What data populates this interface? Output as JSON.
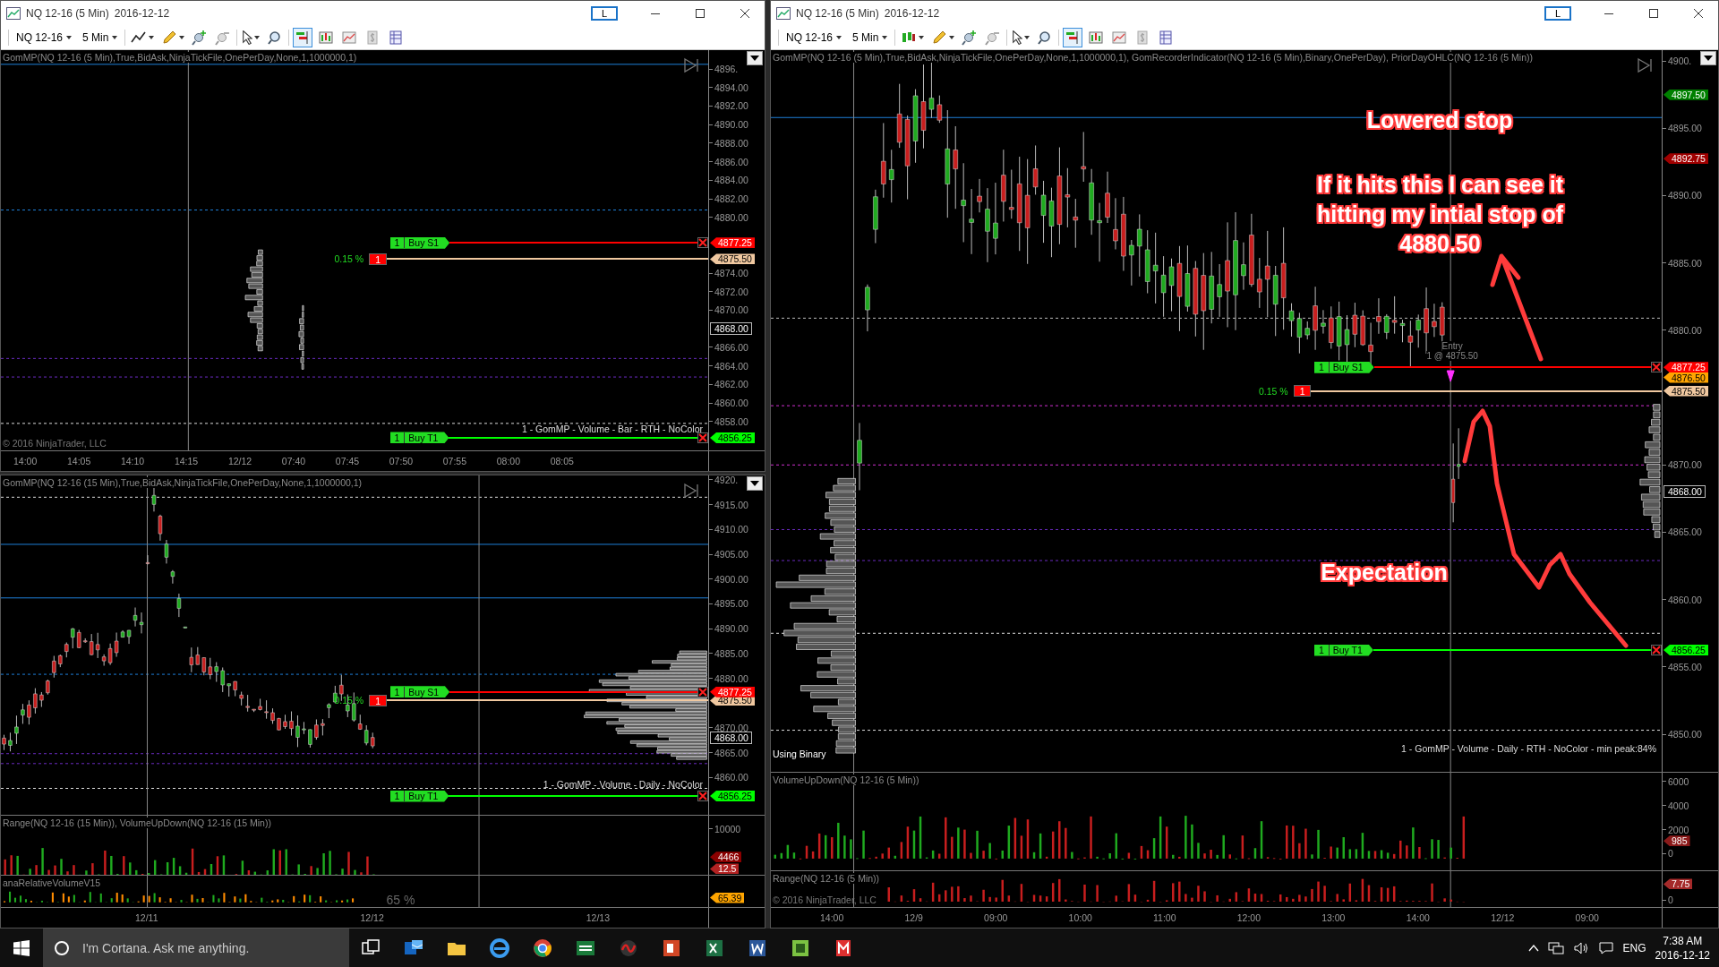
{
  "charts": [
    {
      "title": "NQ 12-16 (5 Min)",
      "date": "2016-12-12",
      "link_button": "L",
      "instrument": "NQ 12-16",
      "interval": "5 Min",
      "panels": [
        {
          "kind": "price",
          "label": "GomMP(NQ 12-16 (5 Min),True,BidAsk,NinjaTickFile,OnePerDay,None,1,1000000,1)",
          "ticks": [
            "4896.",
            "4894.00",
            "4892.00",
            "4890.00",
            "4888.00",
            "4886.00",
            "4884.00",
            "4882.00",
            "4880.00",
            "4874.00",
            "4872.00",
            "4870.00",
            "4866.00",
            "4864.00",
            "4862.00",
            "4860.00",
            "4858.00"
          ],
          "markers": [
            {
              "text": "4877.25",
              "color": "#ff0000",
              "order": {
                "kind": "stop",
                "qty": "1",
                "label": "Buy S1"
              }
            },
            {
              "text": "4875.50",
              "color": "#f0c8a0",
              "order": {
                "kind": "entry",
                "percent": "0.15 %",
                "qty": "1"
              }
            },
            {
              "text": "4868.00",
              "color": "#000000"
            },
            {
              "text": "4856.25",
              "color": "#00ff00",
              "order": {
                "kind": "target",
                "qty": "1",
                "label": "Buy T1"
              }
            }
          ],
          "notes": [
            {
              "kind": "profile",
              "text": "1 - GomMP - Volume - Bar - RTH - NoColor"
            },
            {
              "kind": "copyright",
              "text": "© 2016 NinjaTrader, LLC"
            }
          ]
        }
      ],
      "time_axis": [
        "14:00",
        "14:05",
        "14:10",
        "14:15",
        "12/12",
        "07:40",
        "07:45",
        "07:50",
        "07:55",
        "08:00",
        "08:05"
      ]
    },
    {
      "panels": [
        {
          "kind": "price",
          "label": "GomMP(NQ 12-16 (15 Min),True,BidAsk,NinjaTickFile,OnePerDay,None,1,1000000,1)",
          "ticks": [
            "4920.",
            "4915.00",
            "4910.00",
            "4905.00",
            "4900.00",
            "4895.00",
            "4890.00",
            "4885.00",
            "4880.00",
            "4870.00",
            "4865.00",
            "4860.00"
          ],
          "markers": [
            {
              "text": "4877.25",
              "color": "#ff0000",
              "order": {
                "kind": "stop",
                "qty": "1",
                "label": "Buy S1"
              }
            },
            {
              "text": "4875.50",
              "color": "#f0c8a0",
              "order": {
                "kind": "entry",
                "percent": "0.15 %",
                "qty": "1"
              }
            },
            {
              "text": "4868.00",
              "color": "#000000"
            },
            {
              "text": "4856.25",
              "color": "#00ff00",
              "order": {
                "kind": "target",
                "qty": "1",
                "label": "Buy T1"
              }
            }
          ],
          "notes": [
            {
              "kind": "profile",
              "text": "1 - GomMP - Volume - Daily - NoColor"
            }
          ]
        },
        {
          "kind": "indicator",
          "label": "Range(NQ 12-16 (15 Min)), VolumeUpDown(NQ 12-16 (15 Min))",
          "ticks": [
            "10000"
          ],
          "markers": [
            {
              "text": "4466",
              "color": "#8b0000"
            },
            {
              "text": "12.5",
              "color": "#b22222"
            }
          ]
        },
        {
          "kind": "indicator",
          "label": "anaRelativeVolumeV15",
          "markers": [
            {
              "text": "65.39",
              "color": "#ffa500"
            }
          ],
          "notes": [
            {
              "kind": "reading",
              "text": "65 %"
            }
          ]
        }
      ],
      "time_axis": [
        "12/11",
        "12/12",
        "12/13"
      ]
    },
    {
      "title": "NQ 12-16 (5 Min)",
      "date": "2016-12-12",
      "link_button": "L",
      "instrument": "NQ 12-16",
      "interval": "5 Min",
      "panels": [
        {
          "kind": "price",
          "label": "GomMP(NQ 12-16 (5 Min),True,BidAsk,NinjaTickFile,OnePerDay,None,1,1000000,1), GomRecorderIndicator(NQ 12-16 (5 Min),Binary,OnePerDay), PriorDayOHLC(NQ 12-16 (5 Min))",
          "ticks": [
            "4900.",
            "4895.00",
            "4890.00",
            "4885.00",
            "4880.00",
            "4870.00",
            "4865.00",
            "4860.00",
            "4855.00",
            "4850.00"
          ],
          "markers": [
            {
              "text": "4897.50",
              "color": "#008000"
            },
            {
              "text": "4892.75",
              "color": "#a00000"
            },
            {
              "text": "4877.25",
              "color": "#ff0000",
              "order": {
                "kind": "stop",
                "qty": "1",
                "label": "Buy S1"
              }
            },
            {
              "text": "4876.50",
              "color": "#ffa500"
            },
            {
              "text": "4875.50",
              "color": "#f0c8a0",
              "order": {
                "kind": "entry",
                "percent": "0.15 %",
                "qty": "1",
                "entry_label": "Entry",
                "entry_fill": "1 @ 4875.50"
              }
            },
            {
              "text": "4868.00",
              "color": "#000000"
            },
            {
              "text": "4856.25",
              "color": "#00ff00",
              "order": {
                "kind": "target",
                "qty": "1",
                "label": "Buy T1"
              }
            }
          ],
          "notes": [
            {
              "kind": "profile",
              "text": "1 - GomMP - Volume - Daily - RTH - NoColor - min peak:84%"
            },
            {
              "kind": "caption",
              "text": "Using Binary"
            }
          ],
          "annotations": [
            {
              "text": "Lowered stop"
            },
            {
              "text": "If it hits this I can see it hitting my intial stop of 4880.50"
            },
            {
              "text": "Expectation"
            }
          ]
        },
        {
          "kind": "indicator",
          "label": "VolumeUpDown(NQ 12-16 (5 Min))",
          "ticks": [
            "6000",
            "4000",
            "2000",
            "0"
          ],
          "markers": [
            {
              "text": "985",
              "color": "#8b1a1a"
            }
          ]
        },
        {
          "kind": "indicator",
          "label": "Range(NQ 12-16 (5 Min))",
          "ticks": [
            "0"
          ],
          "markers": [
            {
              "text": "7.75",
              "color": "#a52a2a"
            }
          ],
          "notes": [
            {
              "kind": "copyright",
              "text": "© 2016 NinjaTrader, LLC"
            }
          ]
        }
      ],
      "time_axis": [
        "14:00",
        "12/9",
        "09:00",
        "10:00",
        "11:00",
        "12:00",
        "13:00",
        "14:00",
        "12/12",
        "09:00"
      ]
    }
  ],
  "taskbar": {
    "search": {
      "placeholder": "I'm Cortana. Ask me anything."
    },
    "language": "ENG",
    "time": "7:38 AM",
    "date": "2016-12-12"
  }
}
